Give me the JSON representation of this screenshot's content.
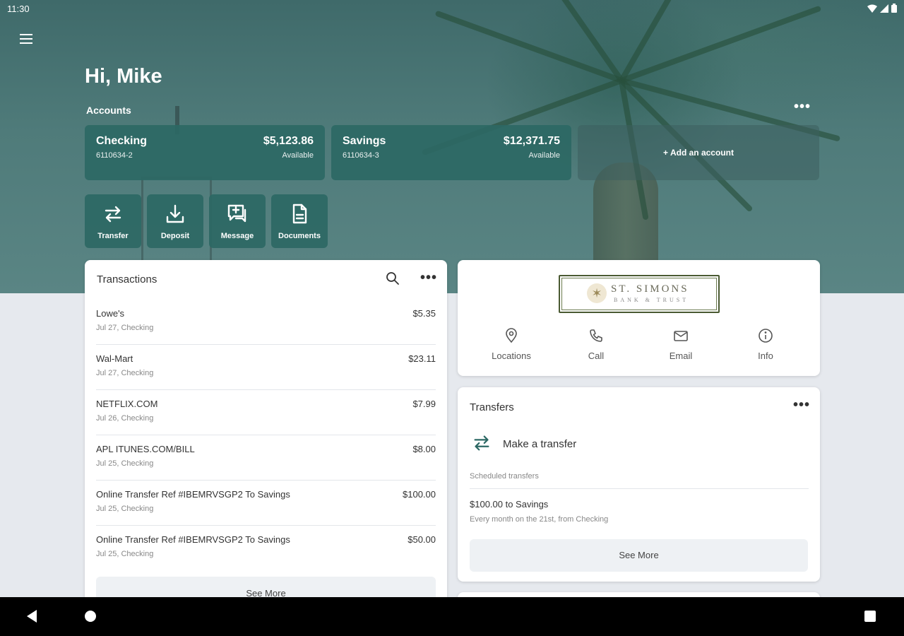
{
  "status_bar": {
    "time": "11:30",
    "wifi_icon": "wifi-icon",
    "signal_icon": "signal-icon",
    "battery_icon": "battery-icon"
  },
  "header": {
    "greeting": "Hi, Mike",
    "accounts_label": "Accounts",
    "more_label": "•••"
  },
  "accounts": [
    {
      "name": "Checking",
      "number": "6110634-2",
      "balance": "$5,123.86",
      "available_label": "Available"
    },
    {
      "name": "Savings",
      "number": "6110634-3",
      "balance": "$12,371.75",
      "available_label": "Available"
    }
  ],
  "add_account_label": "+ Add an account",
  "quick_actions": [
    {
      "label": "Transfer",
      "icon": "transfer-icon"
    },
    {
      "label": "Deposit",
      "icon": "deposit-icon"
    },
    {
      "label": "Message",
      "icon": "message-icon"
    },
    {
      "label": "Documents",
      "icon": "documents-icon"
    }
  ],
  "transactions": {
    "title": "Transactions",
    "more_label": "•••",
    "items": [
      {
        "name": "Lowe's",
        "sub": "Jul 27, Checking",
        "amount": "$5.35"
      },
      {
        "name": "Wal-Mart",
        "sub": "Jul 27, Checking",
        "amount": "$23.11"
      },
      {
        "name": "NETFLIX.COM",
        "sub": "Jul 26, Checking",
        "amount": "$7.99"
      },
      {
        "name": "APL ITUNES.COM/BILL",
        "sub": "Jul 25, Checking",
        "amount": "$8.00"
      },
      {
        "name": "Online Transfer Ref #IBEMRVSGP2 To Savings",
        "sub": "Jul 25, Checking",
        "amount": "$100.00"
      },
      {
        "name": "Online Transfer Ref #IBEMRVSGP2 To Savings",
        "sub": "Jul 25, Checking",
        "amount": "$50.00"
      }
    ],
    "see_more": "See More"
  },
  "bank": {
    "logo_main": "ST. SIMONS",
    "logo_sub": "BANK & TRUST",
    "actions": [
      {
        "label": "Locations",
        "icon": "location-pin-icon"
      },
      {
        "label": "Call",
        "icon": "phone-icon"
      },
      {
        "label": "Email",
        "icon": "email-icon"
      },
      {
        "label": "Info",
        "icon": "info-icon"
      }
    ]
  },
  "transfers": {
    "title": "Transfers",
    "more_label": "•••",
    "make_transfer": "Make a transfer",
    "scheduled_label": "Scheduled transfers",
    "scheduled": [
      {
        "title": "$100.00 to Savings",
        "sub": "Every month on the 21st, from Checking"
      }
    ],
    "see_more": "See More"
  },
  "colors": {
    "accent": "#2c6864",
    "background": "#e6e9ee",
    "card": "#ffffff"
  }
}
